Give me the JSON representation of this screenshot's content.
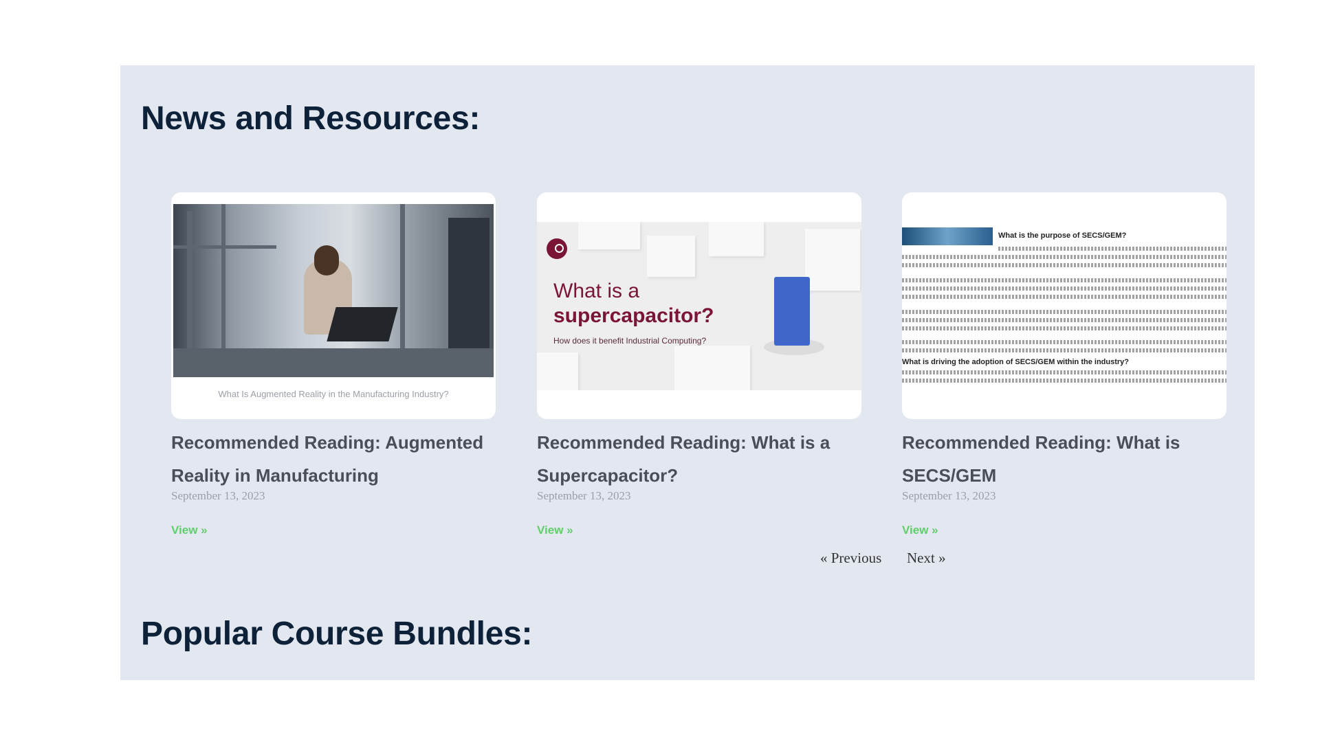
{
  "section": {
    "news_heading": "News and Resources:",
    "bundles_heading": "Popular Course Bundles:"
  },
  "posts": [
    {
      "thumb_caption": "What Is Augmented Reality in the Manufacturing Industry?",
      "title": "Recommended Reading: Augmented Reality in Manufacturing",
      "date": "September 13, 2023",
      "link": "View »"
    },
    {
      "thumb_line1": "What is a",
      "thumb_line2": "supercapacitor?",
      "thumb_line3": "How does it benefit Industrial Computing?",
      "title": "Recommended Reading: What is a Supercapacitor?",
      "date": "September 13, 2023",
      "link": "View »"
    },
    {
      "thumb_heading1": "What is the purpose of SECS/GEM?",
      "thumb_heading2": "What is driving the adoption of SECS/GEM within the industry?",
      "title": "Recommended Reading: What is SECS/GEM",
      "date": "September 13, 2023",
      "link": "View »"
    }
  ],
  "pagination": {
    "previous": "« Previous",
    "next": "Next »"
  },
  "colors": {
    "panel_bg": "#e3e7ef",
    "heading": "#0d2238",
    "link": "#5fcf6b",
    "brand_maroon": "#7a1535"
  }
}
